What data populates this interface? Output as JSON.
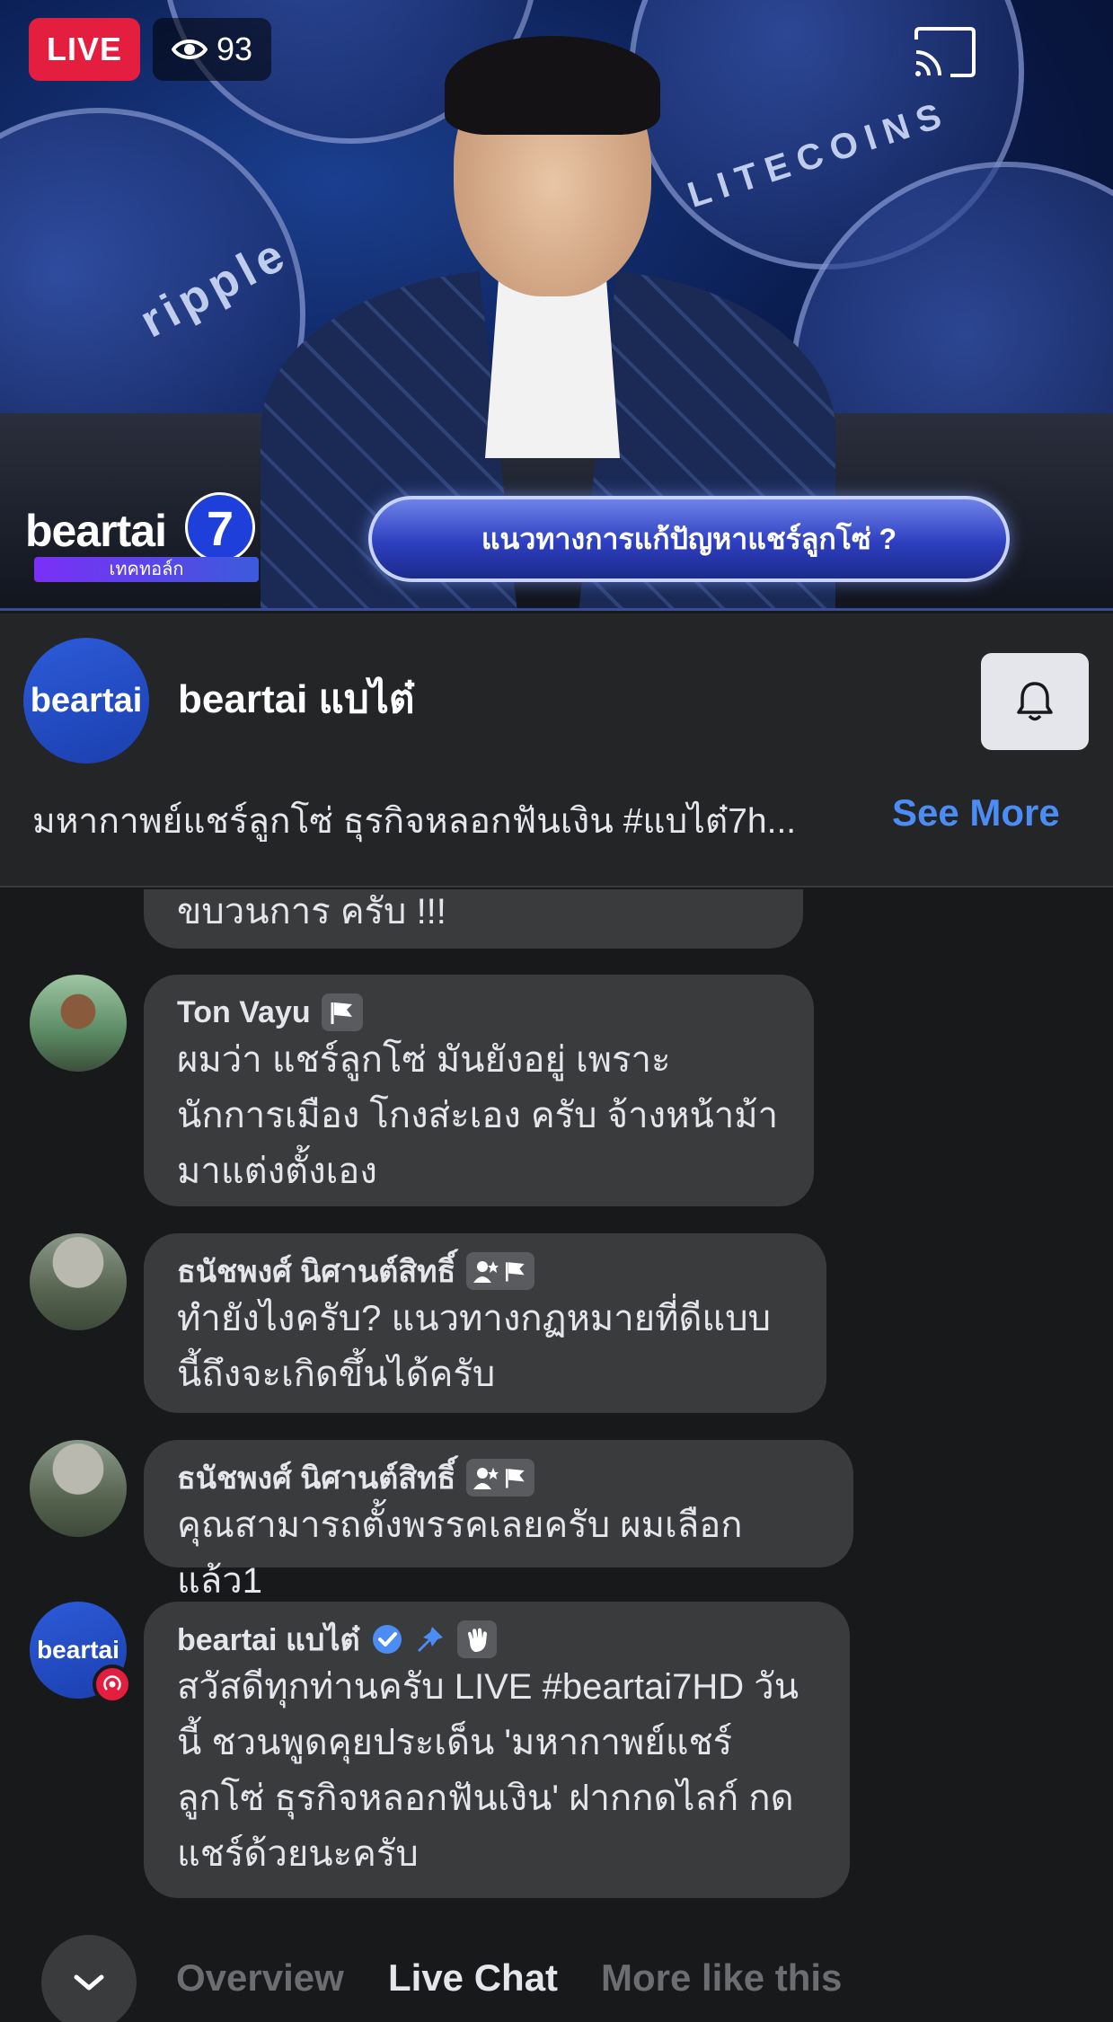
{
  "video": {
    "live_label": "LIVE",
    "viewer_count": "93",
    "headline": "แนวทางการแก้ปัญหาแชร์ลูกโซ่ ?",
    "brand_word": "beartai",
    "brand_number": "7",
    "brand_sub": "เทคทอล์ก",
    "coin_text_1": "ripple",
    "coin_text_2": "LITECOINS"
  },
  "header": {
    "avatar_text": "beartai",
    "page_name": "beartai แบไต๋",
    "description": "มหากาพย์แชร์ลูกโซ่ ธุรกิจหลอกฟันเงิน #แบไต๋7h...",
    "see_more": "See More"
  },
  "chat": {
    "messages": [
      {
        "author": "",
        "text": "ขบวนการ ครับ !!!"
      },
      {
        "author": "Ton Vayu",
        "text": "ผมว่า แชร์ลูกโซ่ มันยังอยู่ เพราะ นักการเมือง โกงส่ะเอง ครับ จ้างหน้าม้า มาแต่งตั้งเอง"
      },
      {
        "author": "ธนัชพงศ์ นิศานต์สิทธิ์",
        "text": "ทำยังไงครับ? แนวทางกฏหมายที่ดีแบบนี้ถึงจะเกิดขึ้นได้ครับ"
      },
      {
        "author": "ธนัชพงศ์ นิศานต์สิทธิ์",
        "text": "คุณสามารถตั้งพรรคเลยครับ ผมเลือกแล้ว1"
      },
      {
        "author": "beartai แบไต๋",
        "avatar_text": "beartai",
        "text": "สวัสดีทุกท่านครับ LIVE #beartai7HD วันนี้ ชวนพูดคุยประเด็น 'มหากาพย์แชร์ลูกโซ่ ธุรกิจหลอกฟันเงิน' ฝากกดไลก์ กดแชร์ด้วยนะครับ"
      }
    ]
  },
  "tabs": {
    "overview": "Overview",
    "live_chat": "Live Chat",
    "more_like_this": "More like this"
  },
  "colors": {
    "live_red": "#e41e3f",
    "link_blue": "#4b8cf5",
    "bubble": "#3a3b3c",
    "background": "#18191a"
  }
}
